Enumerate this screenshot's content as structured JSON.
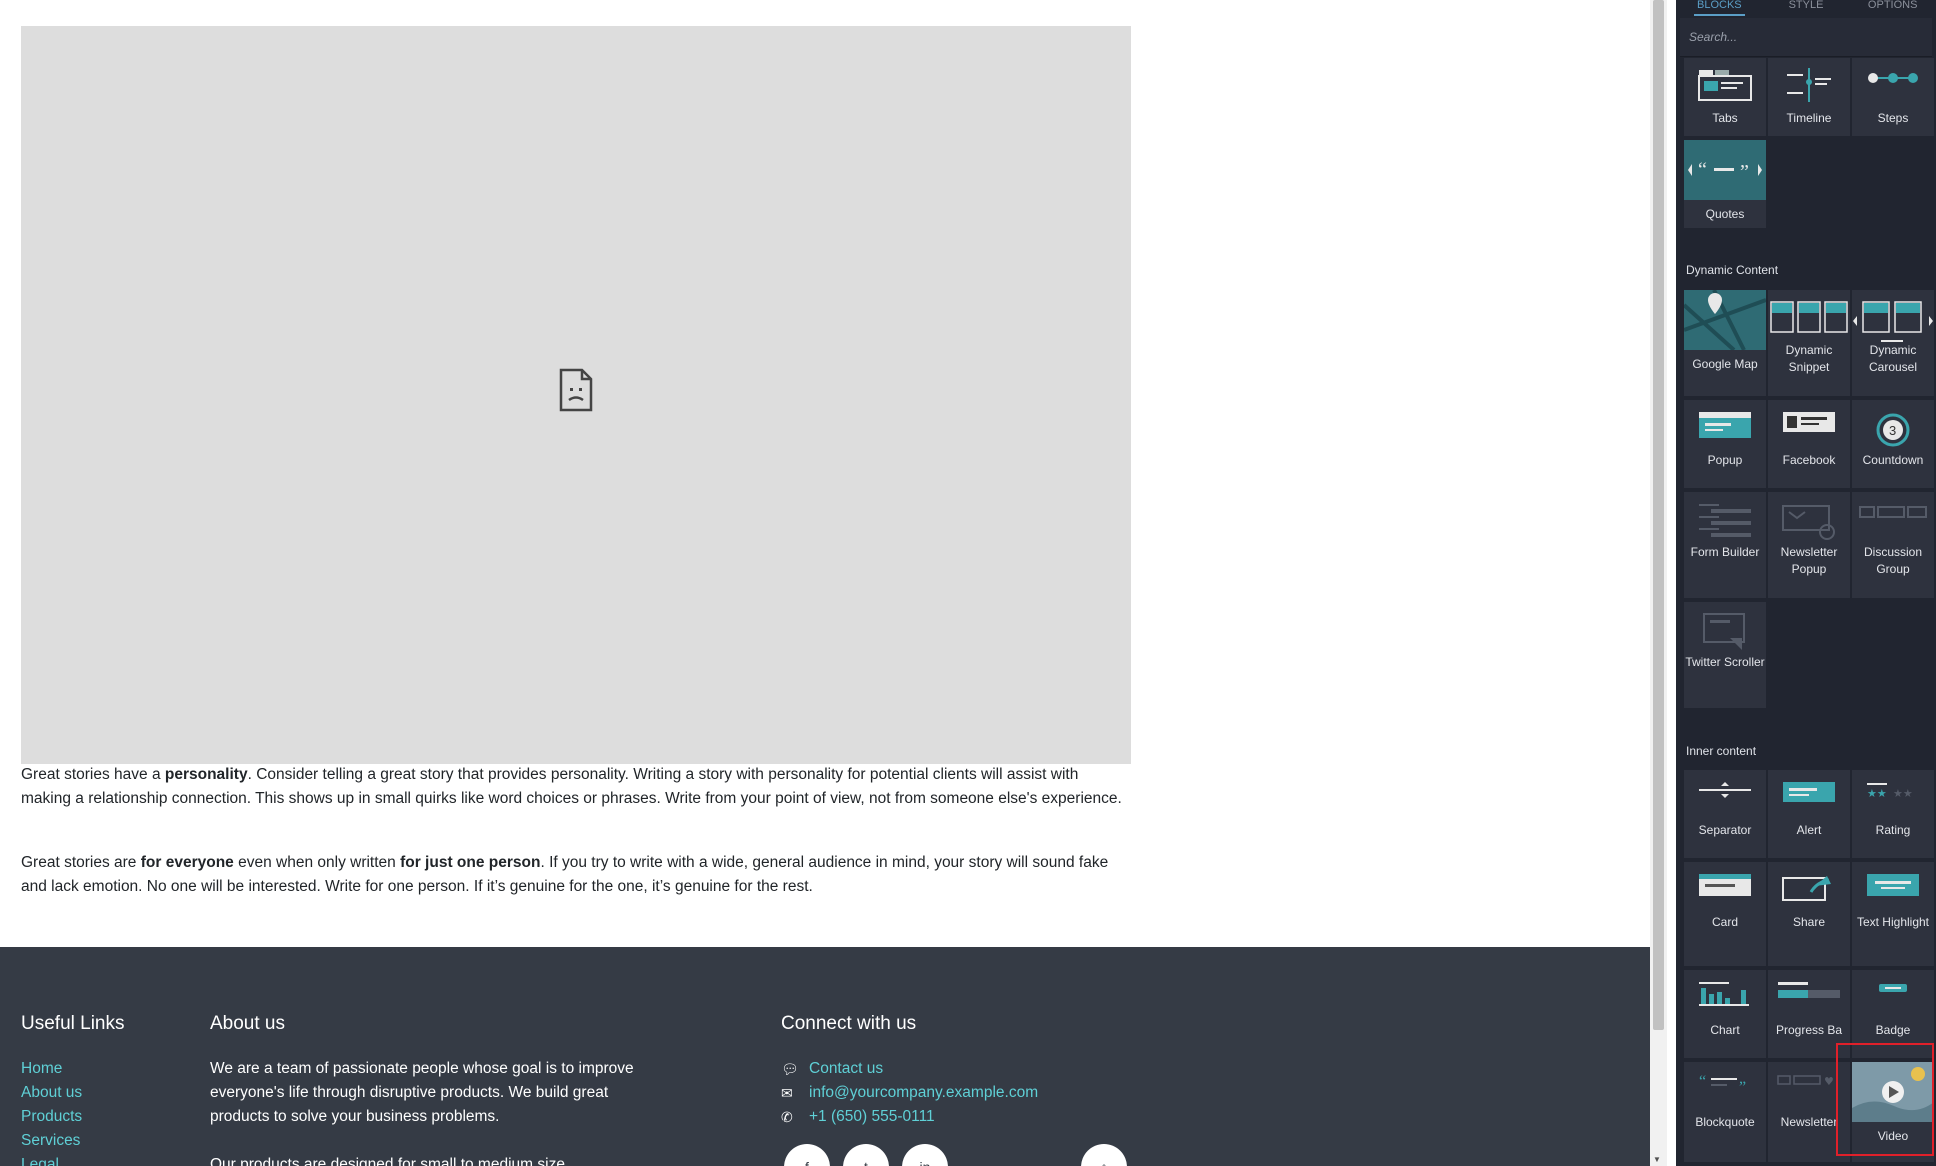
{
  "content": {
    "media_box": {
      "state": "broken-image"
    },
    "paragraphs": [
      {
        "parts": [
          {
            "text": "Great stories have a ",
            "bold": false
          },
          {
            "text": "personality",
            "bold": true
          },
          {
            "text": ". Consider telling a great story that provides personality. Writing a story with personality for potential clients will assist with making a relationship connection. This shows up in small quirks like word choices or phrases. Write from your point of view, not from someone else's experience.",
            "bold": false
          }
        ]
      },
      {
        "parts": [
          {
            "text": "Great stories are ",
            "bold": false
          },
          {
            "text": "for everyone",
            "bold": true
          },
          {
            "text": " even when only written ",
            "bold": false
          },
          {
            "text": "for just one person",
            "bold": true
          },
          {
            "text": ". If you try to write with a wide, general audience in mind, your story will sound fake and lack emotion. No one will be interested. Write for one person. If it’s genuine for the one, it’s genuine for the rest.",
            "bold": false
          }
        ]
      }
    ]
  },
  "footer": {
    "useful_links": {
      "title": "Useful Links",
      "links": [
        "Home",
        "About us",
        "Products",
        "Services",
        "Legal"
      ]
    },
    "about": {
      "title": "About us",
      "text1": "We are a team of passionate people whose goal is to improve everyone's life through disruptive products. We build great products to solve your business problems.",
      "text2": "Our products are designed for small to medium size"
    },
    "connect": {
      "title": "Connect with us",
      "contact_label": "Contact us",
      "email": "info@yourcompany.example.com",
      "phone": "+1 (650) 555-0111"
    },
    "social_icons": [
      "facebook-icon",
      "twitter-icon",
      "linkedin-icon",
      "home-icon"
    ]
  },
  "panel": {
    "tabs": [
      "BLOCKS",
      "STYLE",
      "OPTIONS"
    ],
    "active_tab": "BLOCKS",
    "search_placeholder": "Search...",
    "top_blocks": [
      "Tabs",
      "Timeline",
      "Steps",
      "Quotes"
    ],
    "dynamic_title": "Dynamic Content",
    "dynamic_blocks": [
      "Google Map",
      "Dynamic Snippet",
      "Dynamic Carousel",
      "Popup",
      "Facebook",
      "Countdown",
      "Form Builder",
      "Newsletter Popup",
      "Discussion Group",
      "Twitter Scroller"
    ],
    "inner_title": "Inner content",
    "inner_blocks": [
      "Separator",
      "Alert",
      "Rating",
      "Card",
      "Share",
      "Text Highlight",
      "Chart",
      "Progress Ba",
      "Badge",
      "Blockquote",
      "Newsletter",
      "Video"
    ],
    "highlighted_block": "Video",
    "colors": {
      "panel_bg": "#212530",
      "tile_bg": "#2e323e",
      "accent": "#5b9ec6",
      "teal": "#3aa5ad",
      "highlight_border": "#e0202a"
    }
  }
}
